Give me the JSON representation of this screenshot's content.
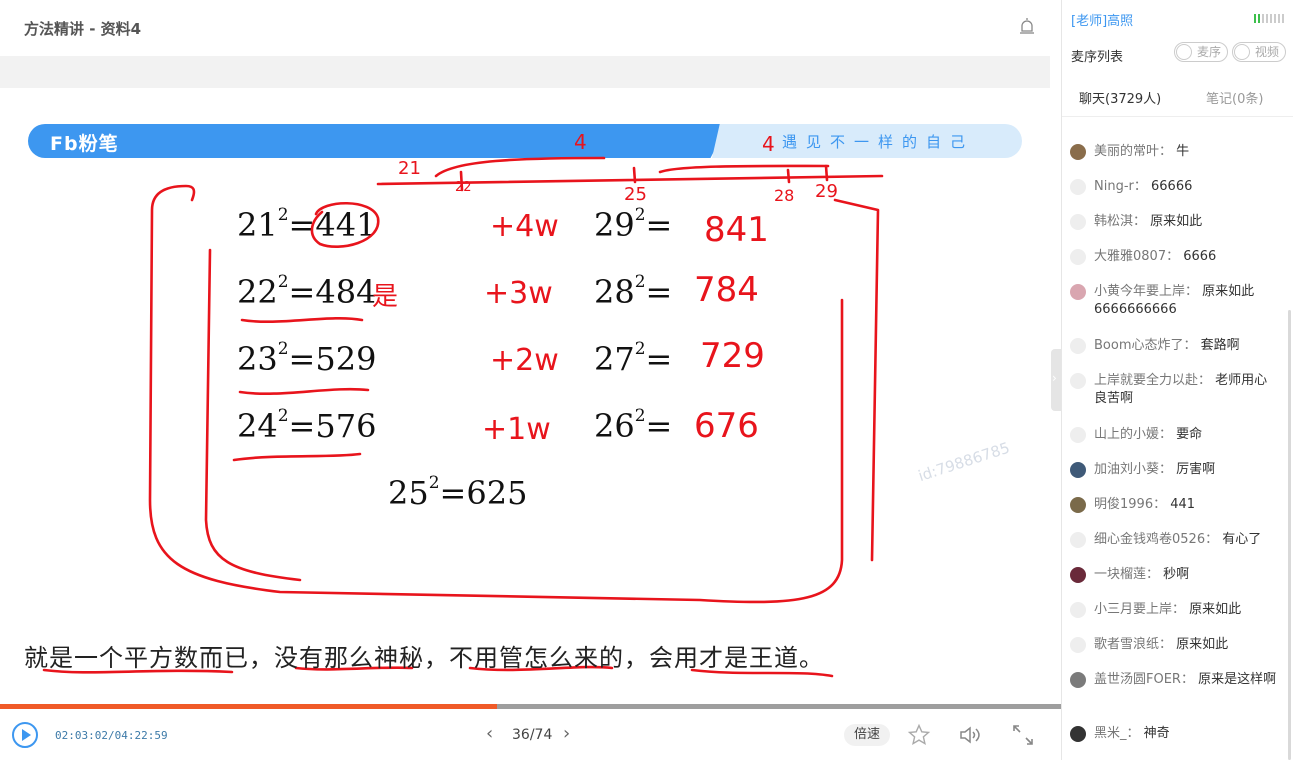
{
  "header": {
    "title": "方法精讲  -  资料4"
  },
  "slide": {
    "brand": "Fb粉笔",
    "slogan": "遇见不一样的自己",
    "left_equations": [
      {
        "base": "21",
        "exp": "2",
        "result": "441"
      },
      {
        "base": "22",
        "exp": "2",
        "result": "484"
      },
      {
        "base": "23",
        "exp": "2",
        "result": "529"
      },
      {
        "base": "24",
        "exp": "2",
        "result": "576"
      }
    ],
    "center_equation": {
      "base": "25",
      "exp": "2",
      "result": "625"
    },
    "right_equations": [
      {
        "base": "29",
        "exp": "2",
        "result": ""
      },
      {
        "base": "28",
        "exp": "2",
        "result": ""
      },
      {
        "base": "27",
        "exp": "2",
        "result": ""
      },
      {
        "base": "26",
        "exp": "2",
        "result": ""
      }
    ],
    "handwriting": {
      "increments": [
        "+4w",
        "+3w",
        "+2w",
        "+1w"
      ],
      "answers": [
        "841",
        "784",
        "729",
        "676"
      ],
      "number_line": [
        "21",
        "22",
        "25",
        "28",
        "29"
      ],
      "brace_labels": [
        "4",
        "4"
      ],
      "side_note": "是"
    },
    "watermark": "id:79886785",
    "subtitle": "就是一个平方数而已，没有那么神秘，不用管怎么来的，会用才是王道。"
  },
  "controls": {
    "time": "02:03:02/04:22:59",
    "page": "36/74",
    "speed_label": "倍速",
    "progress": 0.468
  },
  "sidebar": {
    "teacher": "[老师]高照",
    "queue_label": "麦序列表",
    "toggle_mic": "麦序",
    "toggle_video": "视频",
    "tab_chat": "聊天(3729人)",
    "tab_notes": "笔记(0条)",
    "messages": [
      {
        "nick": "美丽的常叶",
        "text": "牛",
        "avatar": "#8a6d4b"
      },
      {
        "nick": "Ning-r",
        "text": "66666",
        "avatar": ""
      },
      {
        "nick": "韩松淇",
        "text": "原来如此",
        "avatar": ""
      },
      {
        "nick": "大雅雅0807",
        "text": "6666",
        "avatar": ""
      },
      {
        "nick": "小黄今年要上岸",
        "text": "原来如此6666666666",
        "avatar": "#d9a6b0"
      },
      {
        "nick": "Boom心态炸了",
        "text": "套路啊",
        "avatar": ""
      },
      {
        "nick": "上岸就要全力以赴",
        "text": "老师用心良苦啊",
        "avatar": ""
      },
      {
        "nick": "山上的小媛",
        "text": "要命",
        "avatar": ""
      },
      {
        "nick": "加油刘小葵",
        "text": "厉害啊",
        "avatar": "#3f5a78"
      },
      {
        "nick": "明俊1996",
        "text": "441",
        "avatar": "#7a6a4a"
      },
      {
        "nick": "细心金钱鸡卷0526",
        "text": "有心了",
        "avatar": ""
      },
      {
        "nick": "一块榴莲",
        "text": "秒啊",
        "avatar": "#6a2a3a"
      },
      {
        "nick": "小三月要上岸",
        "text": "原来如此",
        "avatar": ""
      },
      {
        "nick": "歌者雪浪纸",
        "text": "原来如此",
        "avatar": ""
      },
      {
        "nick": "盖世汤圆FOER",
        "text": "原来是这样啊",
        "avatar": "#7b7b7b"
      },
      {
        "nick": "黑米_",
        "text": "神奇",
        "avatar": "#333333"
      }
    ]
  }
}
